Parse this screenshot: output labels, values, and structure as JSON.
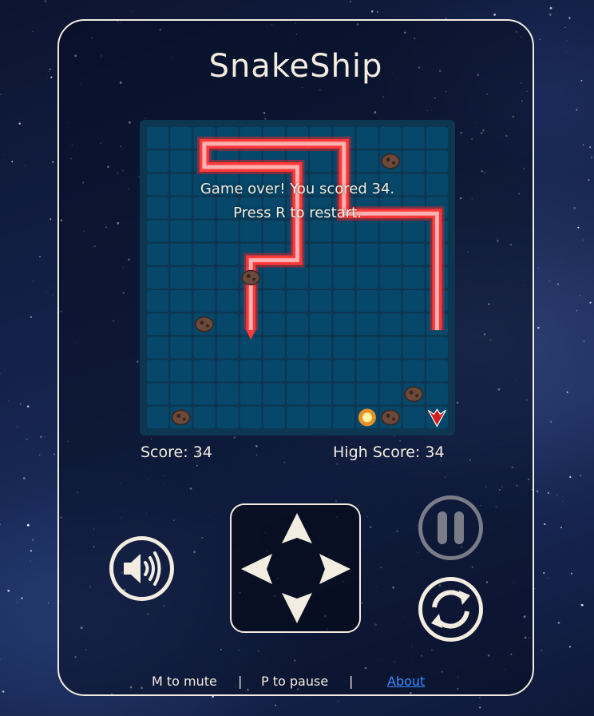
{
  "game": {
    "title": "SnakeShip"
  },
  "message": {
    "line1": "Game over! You scored 34.",
    "line2": "Press R to restart."
  },
  "scoreboard": {
    "score_text": "Score: 34",
    "high_score_text": "High Score: 34"
  },
  "controls": {
    "dpad_icons": [
      "arrow-up-icon",
      "arrow-left-icon",
      "arrow-right-icon",
      "arrow-down-icon"
    ],
    "sound_icon": "speaker-icon",
    "pause_icon": "pause-icon",
    "restart_icon": "restart-icon"
  },
  "footer": {
    "mute_hint": "M to mute",
    "separator": "|",
    "pause_hint": "P to pause",
    "about_link": "About"
  },
  "board": {
    "cols": 13,
    "rows": 13,
    "snake_path": [
      [
        4,
        17
      ],
      [
        4,
        11
      ],
      [
        6,
        11
      ],
      [
        6,
        3
      ],
      [
        2,
        3
      ],
      [
        2,
        1
      ],
      [
        8,
        1
      ],
      [
        8,
        7
      ],
      [
        12,
        7
      ],
      [
        12,
        17
      ]
    ],
    "ship_cell": [
      12,
      12
    ],
    "explosion_cell": [
      9,
      12
    ],
    "asteroids": [
      [
        10,
        1
      ],
      [
        4,
        6
      ],
      [
        2,
        8
      ],
      [
        11,
        11
      ],
      [
        1,
        12
      ],
      [
        10,
        12
      ]
    ],
    "colors": {
      "board_bg": "#0d3650",
      "cell": "#06476a",
      "laser": "#ff3030",
      "text": "#f3ece0",
      "link": "#3d8cff"
    }
  }
}
